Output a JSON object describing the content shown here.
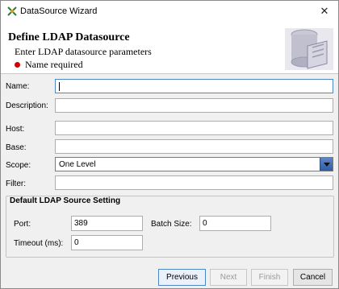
{
  "window": {
    "title": "DataSource Wizard",
    "close_symbol": "✕"
  },
  "header": {
    "title": "Define LDAP Datasource",
    "subtitle": "Enter LDAP datasource parameters",
    "error": "Name required",
    "error_color": "#d40000"
  },
  "form": {
    "name": {
      "label": "Name:",
      "value": ""
    },
    "description": {
      "label": "Description:",
      "value": ""
    },
    "host": {
      "label": "Host:",
      "value": ""
    },
    "base": {
      "label": "Base:",
      "value": ""
    },
    "scope": {
      "label": "Scope:",
      "value": "One Level"
    },
    "filter": {
      "label": "Filter:",
      "value": ""
    }
  },
  "group": {
    "title": "Default LDAP Source Setting",
    "port": {
      "label": "Port:",
      "value": "389"
    },
    "batch_size": {
      "label": "Batch Size:",
      "value": "0"
    },
    "timeout": {
      "label": "Timeout (ms):",
      "value": "0"
    }
  },
  "buttons": {
    "previous": "Previous",
    "next": "Next",
    "finish": "Finish",
    "cancel": "Cancel"
  },
  "icons": {
    "title": "wizard-icon",
    "header": "datasource-graphic-icon"
  }
}
